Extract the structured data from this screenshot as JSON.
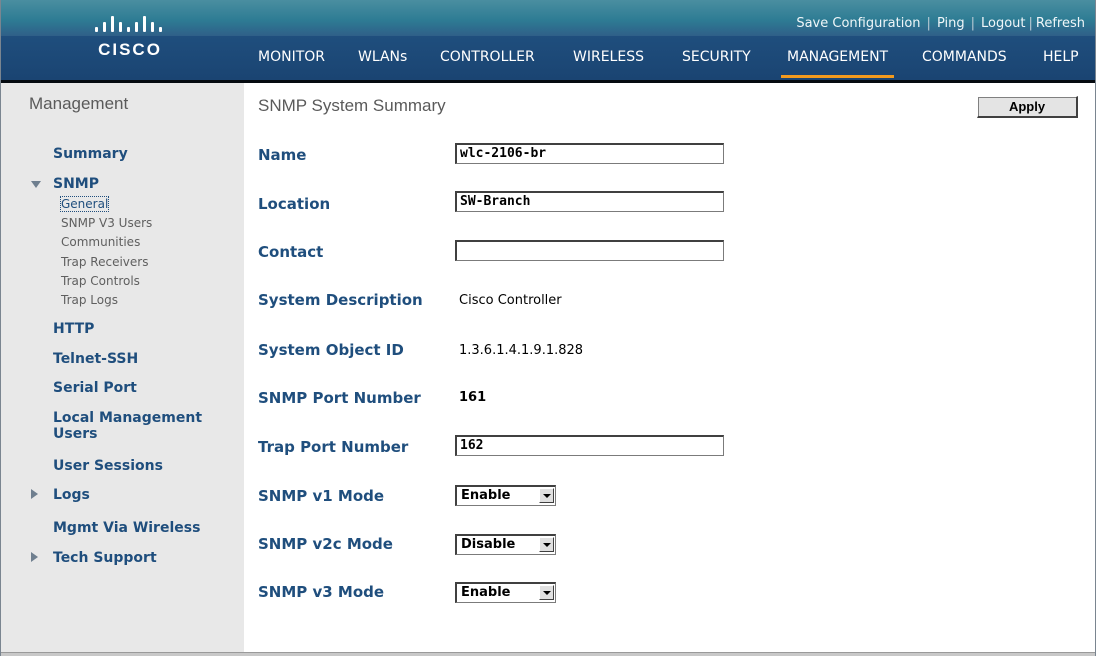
{
  "header": {
    "logo_word": "CISCO",
    "util_links": [
      "Save Configuration",
      "Ping",
      "Logout",
      "Refresh"
    ],
    "nav_tabs": [
      "MONITOR",
      "WLANs",
      "CONTROLLER",
      "WIRELESS",
      "SECURITY",
      "MANAGEMENT",
      "COMMANDS",
      "HELP"
    ],
    "active_tab": "MANAGEMENT",
    "accent_color": "#f29a1e",
    "nav_color": "#1f4e7d"
  },
  "sidebar": {
    "title": "Management",
    "items": {
      "summary": "Summary",
      "snmp": "SNMP",
      "http": "HTTP",
      "telnet_ssh": "Telnet-SSH",
      "serial_port": "Serial Port",
      "local_mgmt_users_line1": "Local Management",
      "local_mgmt_users_line2": "Users",
      "user_sessions": "User Sessions",
      "logs": "Logs",
      "mgmt_via_wireless": "Mgmt Via Wireless",
      "tech_support": "Tech Support"
    },
    "snmp_sub": {
      "general": "General",
      "v3_users": "SNMP V3 Users",
      "communities": "Communities",
      "trap_receivers": "Trap Receivers",
      "trap_controls": "Trap Controls",
      "trap_logs": "Trap Logs"
    }
  },
  "main": {
    "title": "SNMP System Summary",
    "apply_label": "Apply",
    "fields": {
      "name_label": "Name",
      "name_value": "wlc-2106-br",
      "location_label": "Location",
      "location_value": "SW-Branch",
      "contact_label": "Contact",
      "contact_value": "",
      "sysdesc_label": "System Description",
      "sysdesc_value": "Cisco Controller",
      "sysoid_label": "System Object ID",
      "sysoid_value": "1.3.6.1.4.1.9.1.828",
      "snmp_port_label": "SNMP Port Number",
      "snmp_port_value": "161",
      "trap_port_label": "Trap Port Number",
      "trap_port_value": "162",
      "v1_label": "SNMP v1 Mode",
      "v1_value": "Enable",
      "v2c_label": "SNMP v2c Mode",
      "v2c_value": "Disable",
      "v3_label": "SNMP v3 Mode",
      "v3_value": "Enable"
    }
  }
}
